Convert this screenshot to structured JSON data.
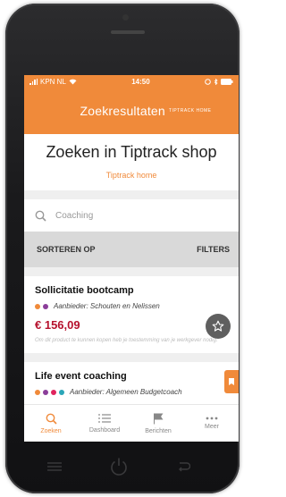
{
  "status": {
    "carrier": "KPN NL",
    "time": "14:50"
  },
  "header": {
    "title": "Zoekresultaten",
    "subtitle": "TIPTRACK HOME"
  },
  "hero": {
    "title": "Zoeken in Tiptrack shop",
    "link": "Tiptrack home"
  },
  "search": {
    "value": "Coaching"
  },
  "sortbar": {
    "sort_label": "SORTEREN OP",
    "filter_label": "FILTERS"
  },
  "results": [
    {
      "title": "Sollicitatie bootcamp",
      "provider": "Aanbieder: Schouten en Nelissen",
      "dots": [
        "#f08a3a",
        "#8b3e9a"
      ],
      "price": "€ 156,09",
      "note": "Om dit product te kunnen kopen heb je toestemming van je werkgever nodig."
    },
    {
      "title": "Life event coaching",
      "provider": "Aanbieder: Algemeen Budgetcoach",
      "dots": [
        "#f08a3a",
        "#8b3e9a",
        "#e0245e",
        "#2aa6b8"
      ]
    }
  ],
  "tabs": [
    {
      "label": "Zoeken",
      "icon": "search-icon"
    },
    {
      "label": "Dashboard",
      "icon": "list-icon"
    },
    {
      "label": "Berichten",
      "icon": "flag-icon"
    },
    {
      "label": "Meer",
      "icon": "more-icon"
    }
  ],
  "colors": {
    "accent": "#f08a3a",
    "price": "#b6122e"
  }
}
